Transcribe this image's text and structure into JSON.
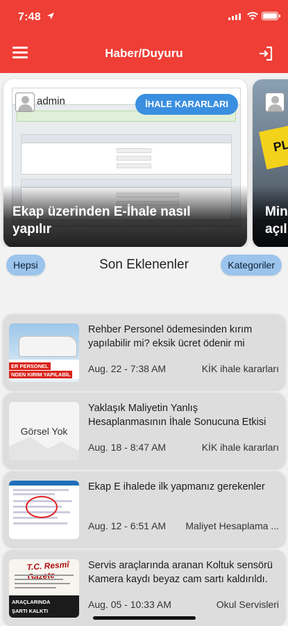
{
  "status_bar": {
    "time": "7:48"
  },
  "app_bar": {
    "title": "Haber/Duyuru"
  },
  "carousel": {
    "current": {
      "author": "admin",
      "category": "İHALE KARARLARI",
      "title_line1": "Ekap üzerinden E-İhale nasıl",
      "title_line2": "yapılır"
    },
    "next": {
      "title_line1": "Min",
      "title_line2": "açıl"
    }
  },
  "section": {
    "all_label": "Hepsi",
    "title": "Son Eklenenler",
    "categories_label": "Kategoriler"
  },
  "items": [
    {
      "title": "Rehber Personel ödemesinden kırım yapılabilir mi? eksik ücret ödenir mi",
      "date": "Aug. 22 - 7:38 AM",
      "category": "KİK ihale kararları",
      "thumb_text_1": "ER PERSONEL",
      "thumb_text_2": "NDEN KIRIM YAPILABİL"
    },
    {
      "title": "Yaklaşık Maliyetin Yanlış Hesaplanmasının İhale Sonucuna Etkisi",
      "date": "Aug. 18 - 8:47 AM",
      "category": "KİK ihale kararları",
      "thumb_text": "Görsel Yok"
    },
    {
      "title": "Ekap E ihalede ilk yapmanız gerekenler",
      "date": "Aug. 12 - 6:51 AM",
      "category": "Maliyet Hesaplama ..."
    },
    {
      "title": "Servis araçlarında aranan Koltuk sensörü Kamera kaydı beyaz cam sartı kaldırıldı.",
      "date": "Aug. 05 - 10:33 AM",
      "category": "Okul Servisleri",
      "thumb_head": "T.C. Resmî Gazete",
      "thumb_text_1": "ARAÇLARINDA",
      "thumb_text_2": "ŞARTI KALKTI"
    }
  ],
  "colors": {
    "primary": "#ee3e36",
    "pill": "#9cc4ec",
    "category_pill": "#3b8fe0",
    "card_bg": "#dddddd"
  }
}
